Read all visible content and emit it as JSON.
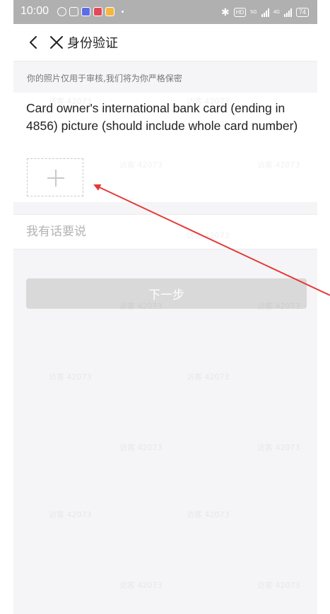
{
  "status_bar": {
    "time": "10:00",
    "network_5g": "5G",
    "network_4g": "4G",
    "hd": "HD",
    "battery": "74"
  },
  "nav": {
    "title": "身份验证"
  },
  "notice": {
    "text": "你的照片仅用于审核,我们将为你严格保密"
  },
  "upload": {
    "description": "Card owner's international bank card (ending in 4856) picture (should include whole card number)"
  },
  "comment": {
    "placeholder": "我有话要说"
  },
  "next_button": {
    "label": "下一步"
  },
  "watermark": {
    "text": "访客 42073"
  },
  "colors": {
    "arrow": "#e53935",
    "button_disabled": "#d9d9d9",
    "status_bar": "#b0b0b0"
  }
}
